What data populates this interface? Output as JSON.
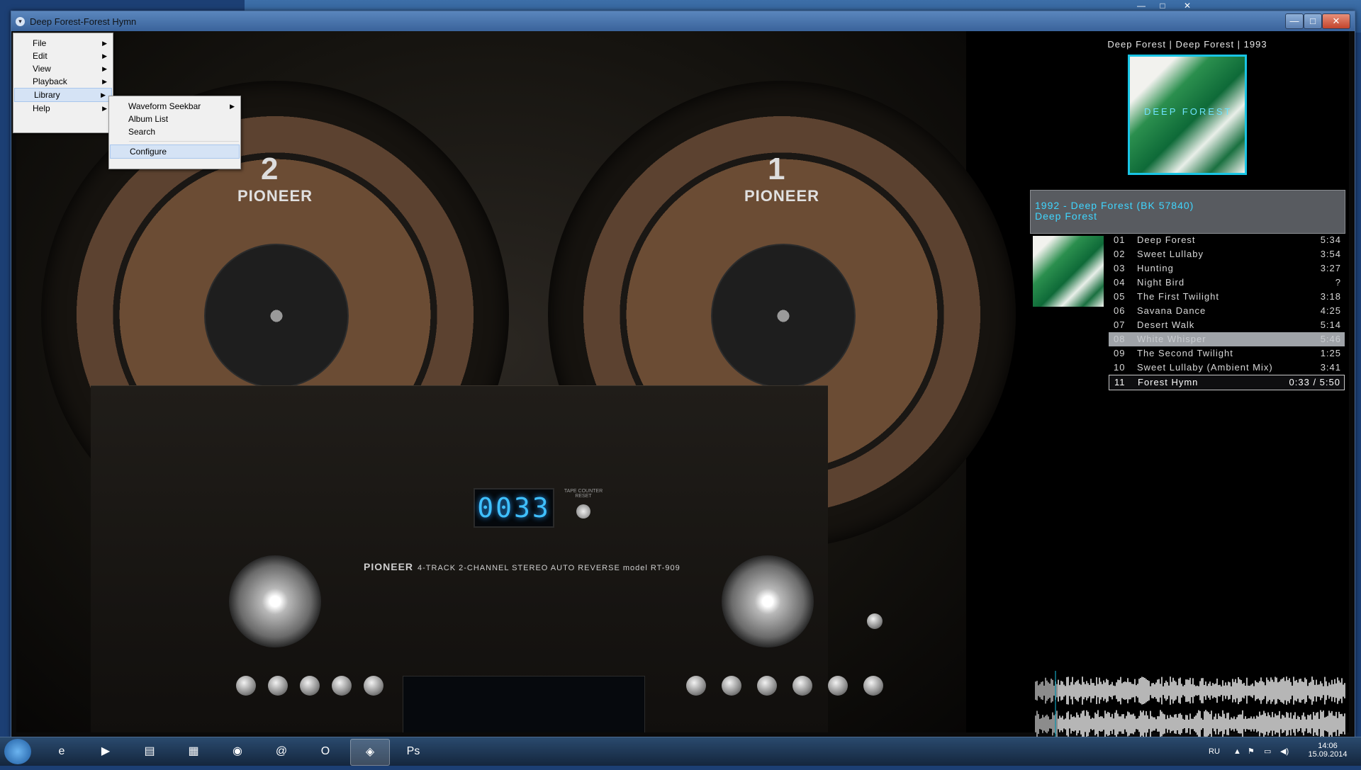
{
  "window": {
    "title": "Deep Forest-Forest Hymn",
    "controls": {
      "minimize": "—",
      "maximize": "□",
      "close": "✕"
    }
  },
  "background_window": {
    "controls": {
      "minimize": "—",
      "maximize": "□",
      "close": "✕"
    }
  },
  "menu": {
    "items": [
      {
        "label": "File"
      },
      {
        "label": "Edit"
      },
      {
        "label": "View"
      },
      {
        "label": "Playback"
      },
      {
        "label": "Library"
      },
      {
        "label": "Help"
      }
    ],
    "open_item": "Library",
    "submenu": {
      "items": [
        {
          "label": "Waveform Seekbar",
          "has_submenu": true
        },
        {
          "label": "Album List"
        },
        {
          "label": "Search"
        },
        {
          "label": "Configure"
        }
      ]
    }
  },
  "deck": {
    "reel_left_number": "2",
    "reel_right_number": "1",
    "reel_brand": "PIONEER",
    "counter": "0033",
    "counter_label": "TAPE COUNTER RESET",
    "model_brand": "PIONEER",
    "model_text": "4-TRACK 2-CHANNEL STEREO AUTO REVERSE model RT-909"
  },
  "now_playing": {
    "meta": "Deep Forest | Deep Forest | 1993",
    "group_title": "1992 - Deep Forest (BK 57840)",
    "group_artist": "Deep Forest"
  },
  "playlist": [
    {
      "num": "01",
      "title": "Deep Forest",
      "duration": "5:34",
      "state": "normal"
    },
    {
      "num": "02",
      "title": "Sweet Lullaby",
      "duration": "3:54",
      "state": "normal"
    },
    {
      "num": "03",
      "title": "Hunting",
      "duration": "3:27",
      "state": "normal"
    },
    {
      "num": "04",
      "title": "Night Bird",
      "duration": "?",
      "state": "normal"
    },
    {
      "num": "05",
      "title": "The First Twilight",
      "duration": "3:18",
      "state": "normal"
    },
    {
      "num": "06",
      "title": "Savana Dance",
      "duration": "4:25",
      "state": "normal"
    },
    {
      "num": "07",
      "title": "Desert Walk",
      "duration": "5:14",
      "state": "normal"
    },
    {
      "num": "08",
      "title": "White Whisper",
      "duration": "5:46",
      "state": "selected"
    },
    {
      "num": "09",
      "title": "The Second Twilight",
      "duration": "1:25",
      "state": "normal"
    },
    {
      "num": "10",
      "title": "Sweet Lullaby (Ambient Mix)",
      "duration": "3:41",
      "state": "normal"
    },
    {
      "num": "11",
      "title": "Forest Hymn",
      "duration": "0:33 / 5:50",
      "state": "playing"
    }
  ],
  "taskbar": {
    "language": "RU",
    "time": "14:06",
    "date": "15.09.2014",
    "apps": [
      {
        "icon": "internet-explorer-icon",
        "glyph": "e"
      },
      {
        "icon": "media-player-icon",
        "glyph": "▶"
      },
      {
        "icon": "file-explorer-icon",
        "glyph": "▤"
      },
      {
        "icon": "calculator-icon",
        "glyph": "▦"
      },
      {
        "icon": "chrome-icon",
        "glyph": "◉"
      },
      {
        "icon": "mail-agent-icon",
        "glyph": "@"
      },
      {
        "icon": "opera-icon",
        "glyph": "O"
      },
      {
        "icon": "foobar-icon",
        "glyph": "◈"
      },
      {
        "icon": "photoshop-icon",
        "glyph": "Ps"
      }
    ]
  },
  "colors": {
    "accent": "#3fd6ff",
    "cover_border": "#19c5e5",
    "playlist_text": "#d8d8d8",
    "selected_row": "#9fa3a8"
  }
}
